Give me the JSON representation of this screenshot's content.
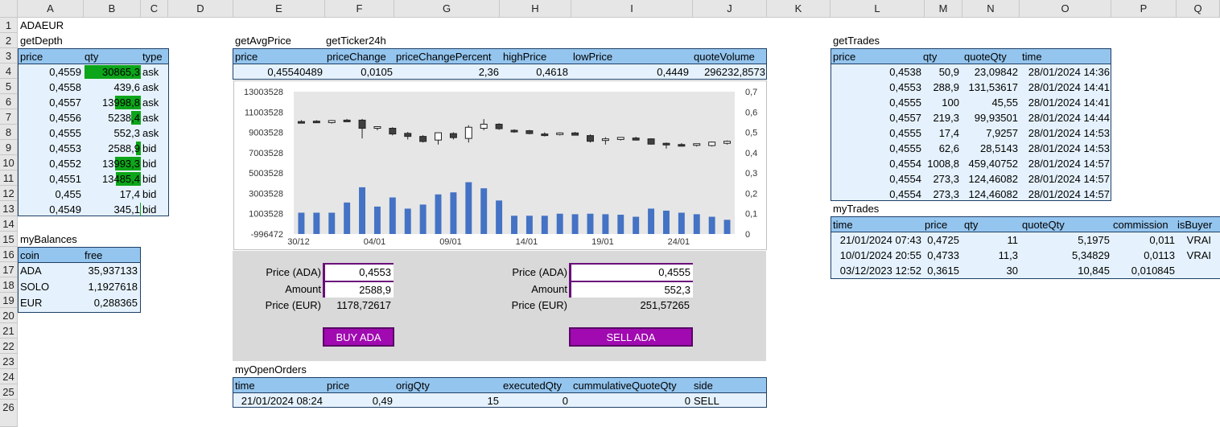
{
  "columns": [
    "A",
    "B",
    "C",
    "D",
    "E",
    "F",
    "G",
    "H",
    "I",
    "J",
    "K",
    "L",
    "M",
    "N",
    "O",
    "P",
    "Q"
  ],
  "rows": [
    "1",
    "2",
    "3",
    "4",
    "5",
    "6",
    "7",
    "8",
    "9",
    "10",
    "11",
    "12",
    "13",
    "14",
    "15",
    "16",
    "17",
    "18",
    "19",
    "20",
    "21",
    "22",
    "23",
    "24",
    "25",
    "26"
  ],
  "symbol": "ADAEUR",
  "depth": {
    "title": "getDepth",
    "headers": [
      "price",
      "qty",
      "type"
    ],
    "rows": [
      {
        "price": "0,4559",
        "qty": "30865,3",
        "type": "ask",
        "fill": 1.0
      },
      {
        "price": "0,4558",
        "qty": "439,6",
        "type": "ask",
        "fill": 0.0
      },
      {
        "price": "0,4557",
        "qty": "13998,8",
        "type": "ask",
        "fill": 0.45
      },
      {
        "price": "0,4556",
        "qty": "5238,4",
        "type": "ask",
        "fill": 0.17
      },
      {
        "price": "0,4555",
        "qty": "552,3",
        "type": "ask",
        "fill": 0.0
      },
      {
        "price": "0,4553",
        "qty": "2588,9",
        "type": "bid",
        "fill": 0.08
      },
      {
        "price": "0,4552",
        "qty": "13993,3",
        "type": "bid",
        "fill": 0.45
      },
      {
        "price": "0,4551",
        "qty": "13485,4",
        "type": "bid",
        "fill": 0.44
      },
      {
        "price": "0,455",
        "qty": "17,4",
        "type": "bid",
        "fill": 0.0
      },
      {
        "price": "0,4549",
        "qty": "345,1",
        "type": "bid",
        "fill": 0.01
      }
    ]
  },
  "balances": {
    "title": "myBalances",
    "headers": [
      "coin",
      "free"
    ],
    "rows": [
      {
        "coin": "ADA",
        "free": "35,937133"
      },
      {
        "coin": "SOLO",
        "free": "1,1927618"
      },
      {
        "coin": "EUR",
        "free": "0,288365"
      }
    ]
  },
  "avg": {
    "title": "getAvgPrice",
    "header": "price",
    "value": "0,45540489"
  },
  "ticker": {
    "title": "getTicker24h",
    "headers": [
      "priceChange",
      "priceChangePercent",
      "highPrice",
      "lowPrice",
      "quoteVolume"
    ],
    "values": [
      "0,0105",
      "2,36",
      "0,4618",
      "0,4449",
      "296232,8573"
    ]
  },
  "trade_panel": {
    "buy": {
      "price_label": "Price (ADA)",
      "price": "0,4553",
      "amount_label": "Amount",
      "amount": "2588,9",
      "eur_label": "Price (EUR)",
      "eur": "1178,72617",
      "button": "BUY ADA"
    },
    "sell": {
      "price_label": "Price (ADA)",
      "price": "0,4555",
      "amount_label": "Amount",
      "amount": "552,3",
      "eur_label": "Price (EUR)",
      "eur": "251,57265",
      "button": "SELL ADA"
    }
  },
  "open_orders": {
    "title": "myOpenOrders",
    "headers": [
      "time",
      "price",
      "origQty",
      "executedQty",
      "cummulativeQuoteQty",
      "side"
    ],
    "rows": [
      {
        "time": "21/01/2024 08:24",
        "price": "0,49",
        "origQty": "15",
        "executedQty": "0",
        "cumm": "0",
        "side": "SELL"
      }
    ]
  },
  "trades": {
    "title": "getTrades",
    "headers": [
      "price",
      "qty",
      "quoteQty",
      "time"
    ],
    "rows": [
      {
        "price": "0,4538",
        "qty": "50,9",
        "quoteQty": "23,09842",
        "time": "28/01/2024 14:36"
      },
      {
        "price": "0,4553",
        "qty": "288,9",
        "quoteQty": "131,53617",
        "time": "28/01/2024 14:41"
      },
      {
        "price": "0,4555",
        "qty": "100",
        "quoteQty": "45,55",
        "time": "28/01/2024 14:41"
      },
      {
        "price": "0,4557",
        "qty": "219,3",
        "quoteQty": "99,93501",
        "time": "28/01/2024 14:44"
      },
      {
        "price": "0,4555",
        "qty": "17,4",
        "quoteQty": "7,9257",
        "time": "28/01/2024 14:53"
      },
      {
        "price": "0,4555",
        "qty": "62,6",
        "quoteQty": "28,5143",
        "time": "28/01/2024 14:53"
      },
      {
        "price": "0,4554",
        "qty": "1008,8",
        "quoteQty": "459,40752",
        "time": "28/01/2024 14:57"
      },
      {
        "price": "0,4554",
        "qty": "273,3",
        "quoteQty": "124,46082",
        "time": "28/01/2024 14:57"
      },
      {
        "price": "0,4554",
        "qty": "273,3",
        "quoteQty": "124,46082",
        "time": "28/01/2024 14:57"
      }
    ]
  },
  "my_trades": {
    "title": "myTrades",
    "headers": [
      "time",
      "price",
      "qty",
      "quoteQty",
      "commission",
      "isBuyer"
    ],
    "rows": [
      {
        "time": "21/01/2024 07:43",
        "price": "0,4725",
        "qty": "11",
        "quoteQty": "5,1975",
        "commission": "0,011",
        "isBuyer": "VRAI"
      },
      {
        "time": "10/01/2024 20:55",
        "price": "0,4733",
        "qty": "11,3",
        "quoteQty": "5,34829",
        "commission": "0,0113",
        "isBuyer": "VRAI"
      },
      {
        "time": "03/12/2023 12:52",
        "price": "0,3615",
        "qty": "30",
        "quoteQty": "10,845",
        "commission": "0,010845",
        "isBuyer": ""
      }
    ]
  },
  "colors": {
    "up": "#ffffff",
    "down": "#404040",
    "volume": "#4472c4",
    "buy_button": "#a00ab0",
    "depth_bar": "#0da51a",
    "header_fill": "#94c5ee",
    "table_fill": "#e5f2fd"
  },
  "chart_data": {
    "type": "candlestick+bar",
    "x_tick_labels": [
      "30/12",
      "04/01",
      "09/01",
      "14/01",
      "19/01",
      "24/01"
    ],
    "y_left_ticks": [
      "13003528",
      "11003528",
      "9003528",
      "7003528",
      "5003528",
      "3003528",
      "1003528",
      "-996472"
    ],
    "y_right_ticks": [
      "0,7",
      "0,6",
      "0,5",
      "0,4",
      "0,3",
      "0,2",
      "0,1",
      "0"
    ],
    "y_left_range": [
      -996472,
      13003528
    ],
    "y_right_range": [
      0,
      0.7
    ],
    "volume": [
      1100000,
      1100000,
      1100000,
      2100000,
      3600000,
      1700000,
      2600000,
      1500000,
      1900000,
      2900000,
      3100000,
      4100000,
      3500000,
      2300000,
      800000,
      800000,
      800000,
      1000000,
      950000,
      1000000,
      950000,
      900000,
      700000,
      1500000,
      1300000,
      1100000,
      950000,
      700000,
      400000
    ],
    "candles": [
      {
        "o": 0.553,
        "h": 0.56,
        "l": 0.547,
        "c": 0.548
      },
      {
        "o": 0.555,
        "h": 0.56,
        "l": 0.55,
        "c": 0.552
      },
      {
        "o": 0.548,
        "h": 0.56,
        "l": 0.543,
        "c": 0.558
      },
      {
        "o": 0.56,
        "h": 0.566,
        "l": 0.55,
        "c": 0.552
      },
      {
        "o": 0.56,
        "h": 0.566,
        "l": 0.47,
        "c": 0.52
      },
      {
        "o": 0.52,
        "h": 0.528,
        "l": 0.51,
        "c": 0.528
      },
      {
        "o": 0.52,
        "h": 0.525,
        "l": 0.485,
        "c": 0.492
      },
      {
        "o": 0.495,
        "h": 0.502,
        "l": 0.465,
        "c": 0.48
      },
      {
        "o": 0.48,
        "h": 0.486,
        "l": 0.45,
        "c": 0.455
      },
      {
        "o": 0.462,
        "h": 0.5,
        "l": 0.44,
        "c": 0.498
      },
      {
        "o": 0.494,
        "h": 0.5,
        "l": 0.465,
        "c": 0.474
      },
      {
        "o": 0.47,
        "h": 0.535,
        "l": 0.45,
        "c": 0.525
      },
      {
        "o": 0.52,
        "h": 0.565,
        "l": 0.51,
        "c": 0.54
      },
      {
        "o": 0.54,
        "h": 0.545,
        "l": 0.512,
        "c": 0.518
      },
      {
        "o": 0.51,
        "h": 0.515,
        "l": 0.498,
        "c": 0.508
      },
      {
        "o": 0.508,
        "h": 0.512,
        "l": 0.49,
        "c": 0.494
      },
      {
        "o": 0.492,
        "h": 0.5,
        "l": 0.48,
        "c": 0.486
      },
      {
        "o": 0.49,
        "h": 0.5,
        "l": 0.485,
        "c": 0.497
      },
      {
        "o": 0.497,
        "h": 0.502,
        "l": 0.485,
        "c": 0.486
      },
      {
        "o": 0.484,
        "h": 0.49,
        "l": 0.45,
        "c": 0.456
      },
      {
        "o": 0.466,
        "h": 0.476,
        "l": 0.44,
        "c": 0.468
      },
      {
        "o": 0.465,
        "h": 0.476,
        "l": 0.46,
        "c": 0.475
      },
      {
        "o": 0.472,
        "h": 0.478,
        "l": 0.46,
        "c": 0.462
      },
      {
        "o": 0.468,
        "h": 0.47,
        "l": 0.44,
        "c": 0.442
      },
      {
        "o": 0.446,
        "h": 0.45,
        "l": 0.42,
        "c": 0.44
      },
      {
        "o": 0.44,
        "h": 0.447,
        "l": 0.43,
        "c": 0.436
      },
      {
        "o": 0.438,
        "h": 0.445,
        "l": 0.43,
        "c": 0.444
      },
      {
        "o": 0.435,
        "h": 0.455,
        "l": 0.43,
        "c": 0.452
      },
      {
        "o": 0.446,
        "h": 0.46,
        "l": 0.44,
        "c": 0.456
      }
    ]
  }
}
